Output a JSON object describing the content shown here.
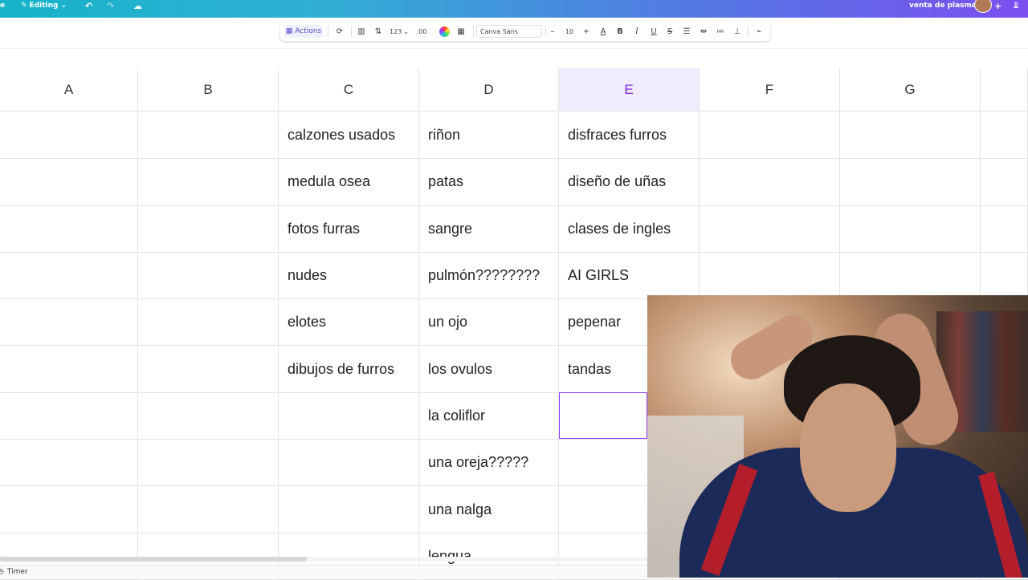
{
  "topbar": {
    "editing_label": "Editing",
    "doc_title": "venta de plasma",
    "edge_letter": "e",
    "plus": "+"
  },
  "toolbar": {
    "actions_label": "Actions",
    "number_format": "123",
    "decimals": ".00",
    "font_name": "Canva Sans",
    "font_size": "10",
    "minus": "–",
    "plus": "+",
    "bold": "B",
    "italic": "I",
    "underline": "U",
    "strike": "S"
  },
  "columns": [
    "A",
    "B",
    "C",
    "D",
    "E",
    "F",
    "G"
  ],
  "selected_column": "E",
  "rows": [
    {
      "C": "calzones usados",
      "D": "riñon",
      "E": "disfraces furros"
    },
    {
      "C": "medula osea",
      "D": "patas",
      "E": "diseño de uñas"
    },
    {
      "C": "fotos furras",
      "D": "sangre",
      "E": "clases de ingles"
    },
    {
      "C": "nudes",
      "D": "pulmón????????",
      "E": "AI GIRLS"
    },
    {
      "C": "elotes",
      "D": "un ojo",
      "E": "pepenar"
    },
    {
      "C": "dibujos de furros",
      "D": "los ovulos",
      "E": "tandas"
    },
    {
      "C": "",
      "D": "la coliflor",
      "E": ""
    },
    {
      "C": "",
      "D": "una oreja?????",
      "E": ""
    },
    {
      "C": "",
      "D": "una nalga",
      "E": ""
    },
    {
      "C": "",
      "D": "lengua",
      "E": ""
    }
  ],
  "footer": {
    "timer_label": "Timer"
  },
  "colors": {
    "accent": "#8b3dff",
    "selected_header_bg": "#f1ecfd",
    "topbar_start": "#16b3c9",
    "topbar_end": "#7c4ff0"
  }
}
